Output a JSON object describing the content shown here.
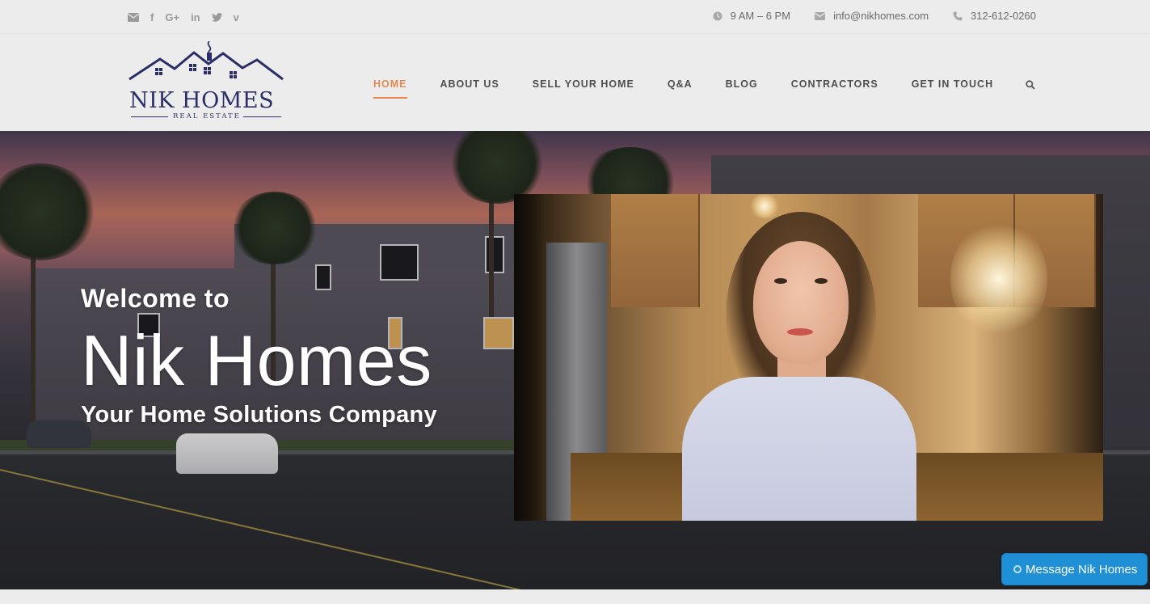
{
  "topbar": {
    "social": [
      {
        "icon": "envelope-icon",
        "glyph": ""
      },
      {
        "icon": "facebook-icon",
        "glyph": "f"
      },
      {
        "icon": "google-plus-icon",
        "glyph": "G+"
      },
      {
        "icon": "linkedin-icon",
        "glyph": "in"
      },
      {
        "icon": "twitter-icon",
        "glyph": ""
      },
      {
        "icon": "vimeo-icon",
        "glyph": "v"
      }
    ],
    "hours": "9 AM – 6 PM",
    "email": "info@nikhomes.com",
    "phone": "312-612-0260"
  },
  "logo": {
    "name": "NIK HOMES",
    "subtitle": "REAL ESTATE",
    "color": "#2b2e66"
  },
  "nav": {
    "items": [
      {
        "label": "HOME",
        "active": true
      },
      {
        "label": "ABOUT US",
        "active": false
      },
      {
        "label": "SELL YOUR HOME",
        "active": false
      },
      {
        "label": "Q&A",
        "active": false
      },
      {
        "label": "BLOG",
        "active": false
      },
      {
        "label": "CONTRACTORS",
        "active": false
      },
      {
        "label": "GET IN TOUCH",
        "active": false
      }
    ],
    "accent": "#e38a4f"
  },
  "hero": {
    "welcome": "Welcome to",
    "title": "Nik Homes",
    "tagline": "Your Home Solutions Company"
  },
  "chat": {
    "label": "Message Nik Homes",
    "color": "#1f8fd6"
  }
}
